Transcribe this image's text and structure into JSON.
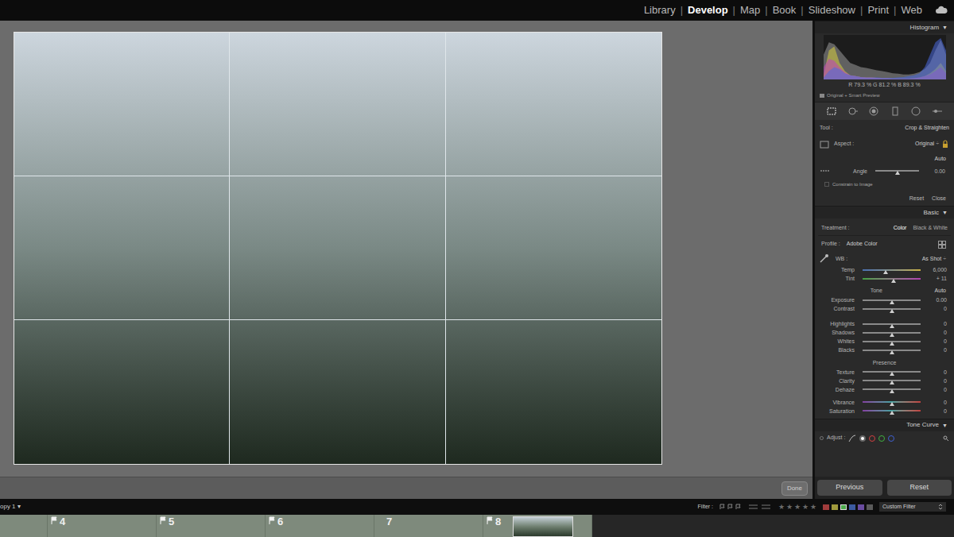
{
  "top_nav": {
    "items": [
      {
        "label": "Library",
        "selected": false
      },
      {
        "label": "Develop",
        "selected": true
      },
      {
        "label": "Map",
        "selected": false
      },
      {
        "label": "Book",
        "selected": false
      },
      {
        "label": "Slideshow",
        "selected": false
      },
      {
        "label": "Print",
        "selected": false
      },
      {
        "label": "Web",
        "selected": false
      }
    ],
    "separator": "|"
  },
  "photo": {
    "crop_overlay": true
  },
  "toolbar": {
    "done_button": "Done"
  },
  "panel": {
    "histogram": {
      "title": "Histogram",
      "toggle": "▼",
      "readout": "R 79.3 % G 81.2 % B 89.3 %",
      "preview": "Original + Smart Preview",
      "series": [
        {
          "name": "gray",
          "color": "#9a9a9a",
          "values": [
            60,
            90,
            85,
            70,
            55,
            40,
            35,
            30,
            28,
            25,
            22,
            20,
            18,
            15,
            14,
            12,
            12,
            14,
            18,
            25,
            40,
            70,
            95,
            60
          ]
        },
        {
          "name": "yellow",
          "color": "#d8d040",
          "values": [
            10,
            70,
            80,
            40,
            20,
            10,
            8,
            6,
            5,
            5,
            4,
            3,
            3,
            2,
            2,
            2,
            2,
            3,
            5,
            8,
            15,
            25,
            40,
            20
          ]
        },
        {
          "name": "magenta",
          "color": "#c040c0",
          "values": [
            30,
            50,
            45,
            30,
            18,
            10,
            8,
            6,
            5,
            5,
            4,
            3,
            3,
            2,
            2,
            2,
            2,
            3,
            5,
            8,
            12,
            20,
            30,
            15
          ]
        },
        {
          "name": "blue",
          "color": "#4a6ae0",
          "values": [
            5,
            20,
            30,
            25,
            15,
            10,
            8,
            6,
            5,
            5,
            5,
            4,
            4,
            4,
            5,
            6,
            8,
            10,
            15,
            30,
            60,
            90,
            100,
            70
          ]
        }
      ]
    },
    "tools": [
      {
        "kind": "crop",
        "selected": true
      },
      {
        "kind": "spot",
        "selected": false
      },
      {
        "kind": "redeye",
        "selected": false
      },
      {
        "kind": "graduated",
        "selected": false
      },
      {
        "kind": "radial",
        "selected": false
      },
      {
        "kind": "brush",
        "selected": false
      }
    ],
    "crop": {
      "tool_label": "Tool :",
      "tool_name": "Crop & Straighten",
      "aspect_label": "Aspect :",
      "aspect_value": "Original",
      "aspect_arrow": "÷",
      "locked": true,
      "auto": "Auto",
      "angle": {
        "label": "Angle",
        "value": "0.00",
        "level": 0.5,
        "kind": "plain"
      },
      "constrain": {
        "label": "Constrain to Image",
        "checked": false
      },
      "buttons": [
        "Reset",
        "Close"
      ]
    },
    "basic": {
      "title": "Basic",
      "toggle": "▼",
      "treatment": {
        "label": "Treatment :",
        "options": [
          {
            "label": "Color",
            "selected": true
          },
          {
            "label": "Black & White",
            "selected": false
          }
        ]
      },
      "profile": {
        "label": "Profile :",
        "value": "Adobe Color"
      },
      "wb": {
        "label": "WB :",
        "value": "As Shot",
        "arrow": "÷"
      },
      "wb_sliders": [
        {
          "label": "Temp",
          "value": "6,000",
          "level": 0.4,
          "kind": "temp"
        },
        {
          "label": "Tint",
          "value": "+ 11",
          "level": 0.53,
          "kind": "tint"
        }
      ],
      "tone": {
        "label": "Tone",
        "auto": "Auto"
      },
      "tone_groups": [
        [
          {
            "label": "Exposure",
            "value": "0.00",
            "level": 0.5,
            "kind": "plain"
          },
          {
            "label": "Contrast",
            "value": "0",
            "level": 0.5,
            "kind": "plain"
          }
        ],
        [
          {
            "label": "Highlights",
            "value": "0",
            "level": 0.5,
            "kind": "plain"
          },
          {
            "label": "Shadows",
            "value": "0",
            "level": 0.5,
            "kind": "plain"
          },
          {
            "label": "Whites",
            "value": "0",
            "level": 0.5,
            "kind": "plain"
          },
          {
            "label": "Blacks",
            "value": "0",
            "level": 0.5,
            "kind": "plain"
          }
        ]
      ],
      "presence": {
        "label": "Presence",
        "groups": [
          [
            {
              "label": "Texture",
              "value": "0",
              "level": 0.5,
              "kind": "plain"
            },
            {
              "label": "Clarity",
              "value": "0",
              "level": 0.5,
              "kind": "plain"
            },
            {
              "label": "Dehaze",
              "value": "0",
              "level": 0.5,
              "kind": "plain"
            }
          ],
          [
            {
              "label": "Vibrance",
              "value": "0",
              "level": 0.5,
              "kind": "color"
            },
            {
              "label": "Saturation",
              "value": "0",
              "level": 0.5,
              "kind": "color"
            }
          ]
        ]
      }
    },
    "tone_curve": {
      "title": "Tone Curve",
      "toggle": "▼",
      "adjust_label": "Adjust :",
      "channels": [
        {
          "color": "#ffffff",
          "selected": true
        },
        {
          "color": "#d04040",
          "selected": false
        },
        {
          "color": "#40b040",
          "selected": false
        },
        {
          "color": "#4060d0",
          "selected": false
        }
      ]
    },
    "bottom_buttons": [
      "Previous",
      "Reset"
    ]
  },
  "filmstrip": {
    "source": "opy 1 ▾",
    "filter_label": "Filter :",
    "star_glyphs": [
      "★",
      "★",
      "★",
      "★",
      "★"
    ],
    "color_labels": [
      {
        "color": "#a03c3c",
        "selected": false
      },
      {
        "color": "#a09a3c",
        "selected": false
      },
      {
        "color": "#4caa4c",
        "selected": true
      },
      {
        "color": "#3c5aa0",
        "selected": false
      },
      {
        "color": "#6a4ca0",
        "selected": false
      },
      {
        "color": "#5a5a5a",
        "selected": false
      }
    ],
    "custom_filter": "Custom Filter",
    "items": [
      {
        "number": "4",
        "flagged": true,
        "has_thumbnail": false
      },
      {
        "number": "5",
        "flagged": true,
        "has_thumbnail": false
      },
      {
        "number": "6",
        "flagged": true,
        "has_thumbnail": false
      },
      {
        "number": "7",
        "flagged": false,
        "has_thumbnail": false
      },
      {
        "number": "8",
        "flagged": true,
        "has_thumbnail": true
      }
    ]
  }
}
